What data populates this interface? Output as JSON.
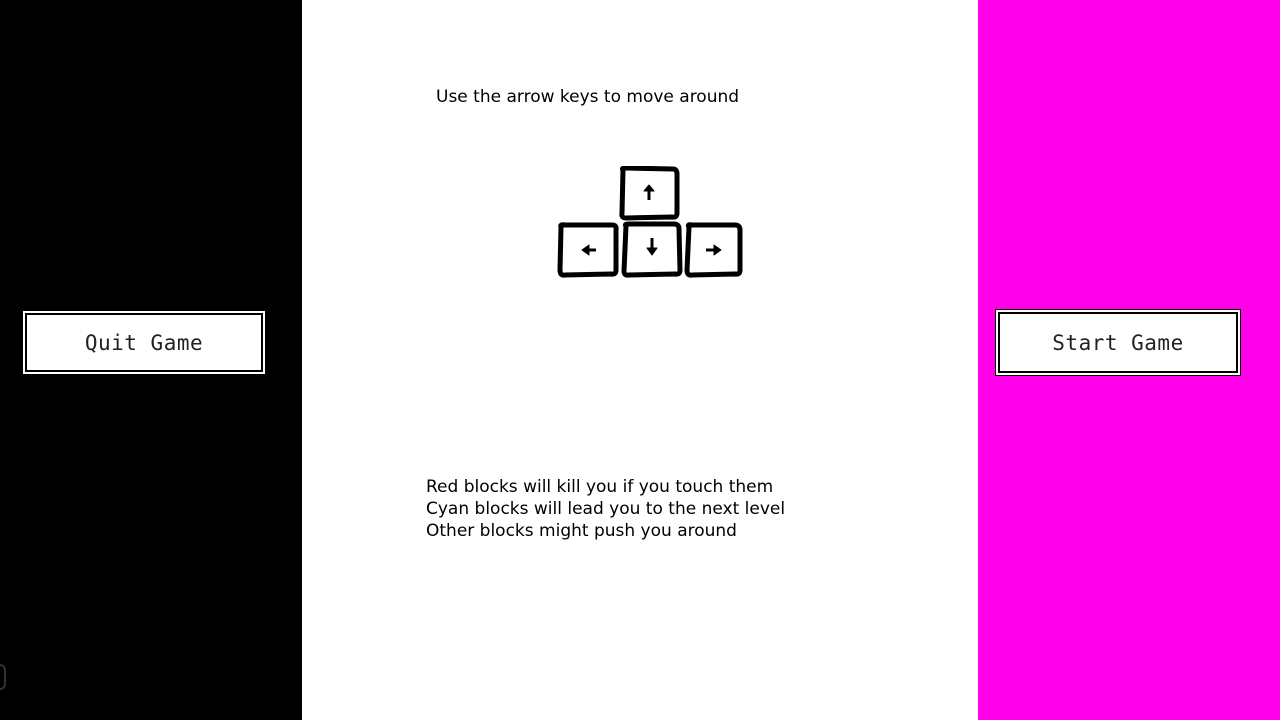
{
  "colors": {
    "left_panel": "#000000",
    "center_panel": "#ffffff",
    "right_panel": "#ff00e8",
    "text": "#000000",
    "button_bg": "#ffffff",
    "button_border": "#000000"
  },
  "buttons": {
    "quit_label": "Quit Game",
    "start_label": "Start Game"
  },
  "instructions": {
    "heading": "Use the arrow keys to move around",
    "arrow_keys": [
      "up-arrow-key-icon",
      "left-arrow-key-icon",
      "down-arrow-key-icon",
      "right-arrow-key-icon"
    ],
    "rules": [
      "Red blocks will kill you if you touch them",
      "Cyan blocks will lead you to the next level",
      "Other blocks might push you around"
    ]
  }
}
